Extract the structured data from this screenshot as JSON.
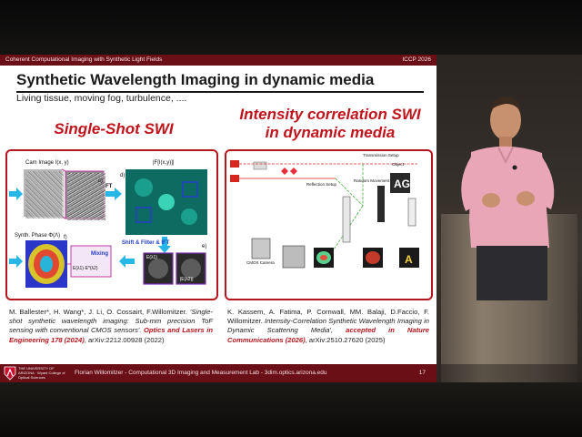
{
  "header": {
    "left_text": "Coherent Computational Imaging with Synthetic Light Fields",
    "right_text": "ICCP 2026"
  },
  "slide": {
    "title": "Synthetic Wavelength Imaging in dynamic media",
    "subtitle": "Living tissue, moving fog, turbulence, ...."
  },
  "left_column": {
    "heading": "Single-Shot SWI",
    "labels": {
      "cam_image": "Cam Image I(x, y)",
      "c": "c)",
      "d": "d)",
      "e": "e)",
      "f": "f)",
      "ft_label": "|F[I(x,y)]|",
      "ft": "FT",
      "shift": "Shift & Filter & IFT",
      "mixing": "Mixing",
      "synth_phase": "Synth. Phase Φ(Λ)",
      "e1": "E(λ1)",
      "e2": "|E(λ2)|",
      "mix_formula": "E(λ1)·E*(λ2)"
    },
    "citation": {
      "authors": "M. Ballester*, H. Wang*, J. Li, O. Cossairt, F.Willomitzer.",
      "title": "'Single-shot synthetic wavelength imaging: Sub-mm precision ToF sensing with conventional CMOS sensors'.",
      "journal": "Optics and Lasers in Engineering 178 (2024)",
      "arxiv": ", arXiv:2212.00928 (2022)"
    }
  },
  "right_column": {
    "heading_line1": "Intensity correlation SWI",
    "heading_line2": "in dynamic media",
    "labels": {
      "transmission": "Transmission Setup",
      "reflection": "Reflection Setup",
      "cmos": "CMOS Camera",
      "random_movement": "Random Movement",
      "object": "Object",
      "letters": "AG"
    },
    "citation": {
      "authors": "K. Kassem, A. Fatima, P. Cornwall, MM. Balaji, D.Faccio, F. Willomitzer.",
      "title": "Intensity-Correlation Synthetic Wavelength Imaging in Dynamic Scattering Media',",
      "status": "accepted in Nature Communications (2026)",
      "arxiv": ", arXiv:2510.27620 (2025)"
    }
  },
  "footer": {
    "college": "THE UNIVERSITY OF ARIZONA · Wyant College of Optical Sciences",
    "text": "Florian Willomitzer - Computational 3D Imaging and Measurement Lab - 3dim.optics.arizona.edu",
    "page": "17"
  },
  "colors": {
    "accent_red": "#c0141c",
    "bar_maroon": "#6b0f17",
    "shirt_pink": "#e9a6b6"
  }
}
